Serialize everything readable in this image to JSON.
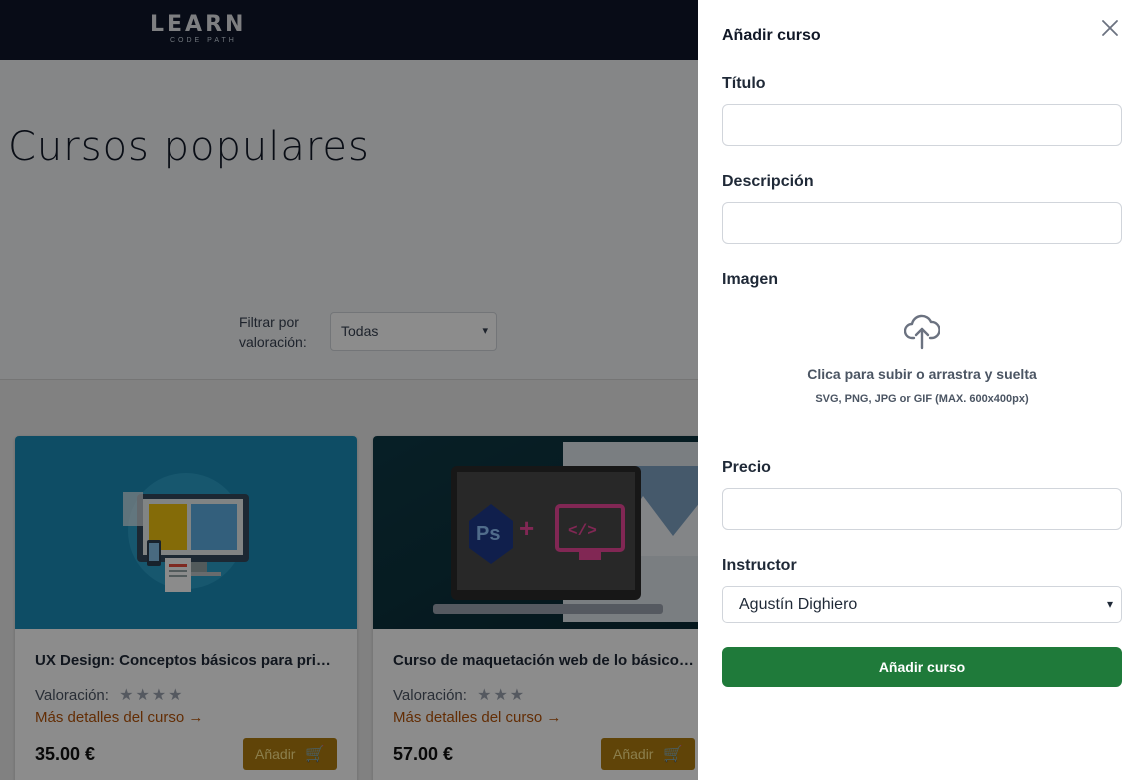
{
  "header": {
    "logo_main": "LEARN",
    "logo_sub": "CODE PATH"
  },
  "hero": {
    "title": "Cursos populares",
    "filter_label": "Filtrar por valoración:",
    "filter_value": "Todas"
  },
  "courses": [
    {
      "title": "UX Design: Conceptos básicos para princip...",
      "rating_label": "Valoración:",
      "stars": 4,
      "details_link": "Más detalles del curso →",
      "price": "35.00 €",
      "add_label": "Añadir"
    },
    {
      "title": "Curso de maquetación web de lo básico a ...",
      "rating_label": "Valoración:",
      "stars": 3,
      "details_link": "Más detalles del curso →",
      "price": "57.00 €",
      "add_label": "Añadir"
    }
  ],
  "drawer": {
    "title": "Añadir curso",
    "title_label": "Título",
    "title_value": "",
    "description_label": "Descripción",
    "description_value": "",
    "image_label": "Imagen",
    "upload_main": "Clica para subir o arrastra y suelta",
    "upload_hint": "SVG, PNG, JPG or GIF (MAX. 600x400px)",
    "price_label": "Precio",
    "price_value": "",
    "instructor_label": "Instructor",
    "instructor_value": "Agustín Dighiero",
    "submit_label": "Añadir curso"
  },
  "colors": {
    "topbar": "#0f172a",
    "submit": "#1f7a3a",
    "accent": "#b45309",
    "card_button": "#b07d10"
  }
}
